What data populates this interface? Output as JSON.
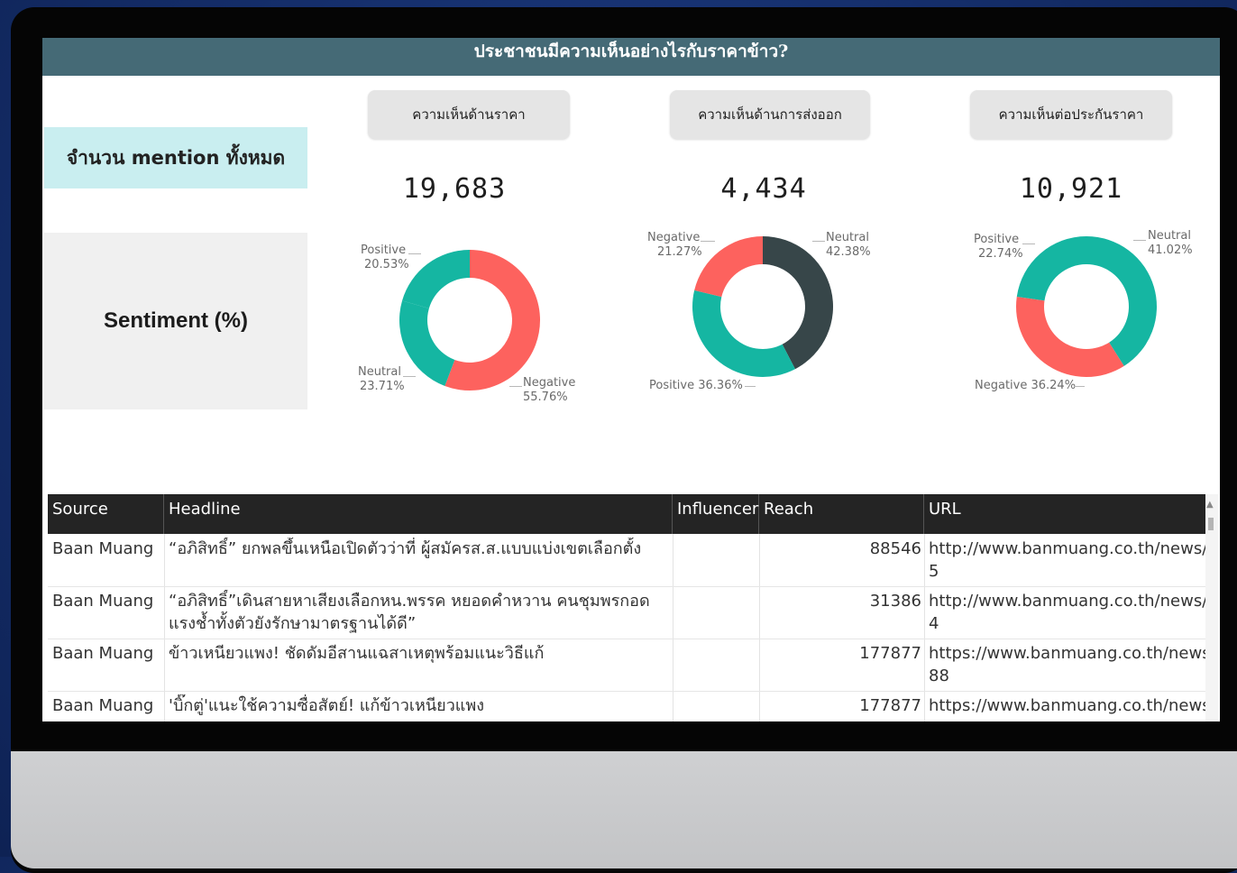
{
  "title": "ประชาชนมีความเห็นอย่างไรกับราคาข้าว?",
  "left_panel": {
    "mention_label": "จำนวน mention ทั้งหมด",
    "sentiment_label": "Sentiment (%)"
  },
  "colors": {
    "positive": "#15b6a2",
    "negative": "#fd625e",
    "neutral": "#374649",
    "header_bar": "#456a76"
  },
  "topics": [
    {
      "tab_label": "ความเห็นด้านราคา",
      "mention_count": "19,683",
      "labels": {
        "positive": [
          "Positive",
          "20.53%"
        ],
        "neutral": [
          "Neutral",
          "23.71%"
        ],
        "negative": [
          "Negative",
          "55.76%"
        ]
      }
    },
    {
      "tab_label": "ความเห็นด้านการส่งออก",
      "mention_count": "4,434",
      "labels": {
        "negative": [
          "Negative",
          "21.27%"
        ],
        "neutral": [
          "Neutral",
          "42.38%"
        ],
        "positive": [
          "Positive 36.36%"
        ]
      }
    },
    {
      "tab_label": "ความเห็นต่อประกันราคา",
      "mention_count": "10,921",
      "labels": {
        "positive": [
          "Positive",
          "22.74%"
        ],
        "neutral": [
          "Neutral",
          "41.02%"
        ],
        "negative": [
          "Negative 36.24%"
        ]
      }
    }
  ],
  "chart_data": [
    {
      "type": "pie",
      "title": "ความเห็นด้านราคา",
      "categories": [
        "Negative",
        "Neutral",
        "Positive"
      ],
      "values": [
        55.76,
        23.71,
        20.53
      ],
      "colors": [
        "#fd625e",
        "#15b6a2",
        "#15b6a2"
      ]
    },
    {
      "type": "pie",
      "title": "ความเห็นด้านการส่งออก",
      "categories": [
        "Neutral",
        "Positive",
        "Negative"
      ],
      "values": [
        42.38,
        36.36,
        21.27
      ],
      "colors": [
        "#374649",
        "#15b6a2",
        "#fd625e"
      ]
    },
    {
      "type": "pie",
      "title": "ความเห็นต่อประกันราคา",
      "categories": [
        "Neutral",
        "Negative",
        "Positive"
      ],
      "values": [
        41.02,
        36.24,
        22.74
      ],
      "colors": [
        "#15b6a2",
        "#fd625e",
        "#15b6a2"
      ]
    }
  ],
  "table": {
    "columns": [
      "Source",
      "Headline",
      "Influencer",
      "Reach",
      "URL"
    ],
    "rows": [
      {
        "source": "Baan Muang",
        "headline": "“อภิสิทธิ์” ยกพลขึ้นเหนือเปิดตัวว่าที่ ผู้สมัครส.ส.แบบแบ่งเขตเลือกตั้ง",
        "influencer": "",
        "reach": "88546",
        "url": "http://www.banmuang.co.th/news/po",
        "url2": "5"
      },
      {
        "source": "Baan Muang",
        "headline": "“อภิสิทธิ์”เดินสายหาเสียงเลือกหน.พรรค หยอดคำหวาน คนชุมพรกอด แรงช้ำทั้งตัวยังรักษามาตรฐานได้ดี”",
        "influencer": "",
        "reach": "31386",
        "url": "http://www.banmuang.co.th/news/po",
        "url2": "4"
      },
      {
        "source": "Baan Muang",
        "headline": "ข้าวเหนียวแพง! ชัดดัมอีสานแฉสาเหตุพร้อมแนะวิธีแก้",
        "influencer": "",
        "reach": "177877",
        "url": "https://www.banmuang.co.th/news/p",
        "url2": "88"
      },
      {
        "source": "Baan Muang",
        "headline": "'บิ๊กตู่'แนะใช้ความซื่อสัตย์! แก้ข้าวเหนียวแพง",
        "influencer": "",
        "reach": "177877",
        "url": "https://www.banmuang.co.th/news/p",
        "url2": ""
      }
    ]
  }
}
